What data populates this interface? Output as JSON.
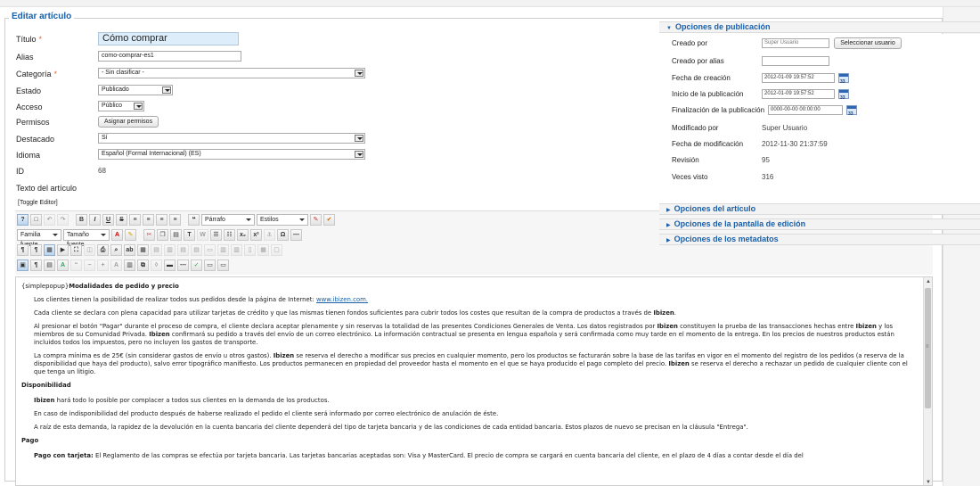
{
  "form": {
    "legend": "Editar artículo",
    "fields": {
      "titulo": {
        "label": "Título",
        "required_mark": "*",
        "value": "Cómo comprar"
      },
      "alias": {
        "label": "Alias",
        "value": "como-comprar-es1"
      },
      "categoria": {
        "label": "Categoría",
        "required_mark": "*",
        "value": "- Sin clasificar -"
      },
      "estado": {
        "label": "Estado",
        "value": "Publicado"
      },
      "acceso": {
        "label": "Acceso",
        "value": "Público"
      },
      "permisos": {
        "label": "Permisos",
        "button": "Asignar permisos"
      },
      "destacado": {
        "label": "Destacado",
        "value": "Sí"
      },
      "idioma": {
        "label": "Idioma",
        "value": "Español (Formal Internacional) (ES)"
      },
      "id": {
        "label": "ID",
        "value": "68"
      },
      "texto": {
        "label": "Texto del artículo"
      }
    },
    "toggle_editor": "[Toggle Editor]"
  },
  "toolbar": {
    "format_select": "Párrafo",
    "styles_select": "Estilos",
    "font_family": "Familia fuente",
    "font_size": "Tamaño fuente",
    "icons_row1": [
      "help-icon",
      "new-doc-icon",
      "undo-icon",
      "redo-icon",
      "bold-icon",
      "italic-icon",
      "underline-icon",
      "strikethrough-icon",
      "align-left-icon",
      "align-center-icon",
      "align-right-icon",
      "blockquote-icon",
      "clean-icon",
      "template-icon"
    ],
    "icon_glyphs_row1": [
      "?",
      "□",
      "↶",
      "↷",
      "B",
      "I",
      "U",
      "S",
      "≡",
      "≡",
      "≡",
      "❝",
      "✎",
      "✔"
    ]
  },
  "editor": {
    "p0_prefix": "{simplepopup}",
    "p0_bold": "Modalidades de pedido y precio",
    "p1_text": "Los clientes tienen la posibilidad de realizar todos sus pedidos desde la página de Internet: ",
    "p1_link": "www.ibizen.com.",
    "p2_text": "Cada cliente se declara con plena capacidad para utilizar tarjetas de crédito y que las mismas tienen fondos suficientes para cubrir todos los costes que resultan de la compra de productos a través de ",
    "p2_bold": "Ibizen",
    "p3_a": "Al presionar el botón \"Pagar\" durante el proceso de compra, el cliente declara aceptar plenamente y sin reservas la totalidad de las presentes Condiciones Generales de Venta. Los datos registrados por ",
    "p3_b1": "Ibizen",
    "p3_c": " constituyen la prueba de las transacciones hechas entre ",
    "p3_b2": "Ibizen",
    "p3_d": " y los miembros de su Comunidad Privada. ",
    "p3_b3": "Ibizen",
    "p3_e": " confirmará su pedido a través del envío de un correo electrónico. La información contractual se presenta en lengua española y será confirmada como muy tarde en el momento de la entrega. En los precios de nuestros productos están incluidos todos los impuestos, pero no incluyen los gastos de transporte.",
    "p4_a": "La compra mínima es de 25€ (sin considerar gastos de envío u otros gastos). ",
    "p4_b1": "Ibizen",
    "p4_c": " se reserva el derecho a modificar sus precios en cualquier momento, pero los productos se facturarán sobre la base de las tarifas en vigor en el momento del registro de los pedidos (a reserva de la disponibilidad que haya del producto), salvo error tipográfico manifiesto. Los productos permanecen en propiedad del proveedor hasta el momento en el que se haya producido el pago completo del precio. ",
    "p4_b2": "Ibizen",
    "p4_d": " se reserva el derecho a rechazar un pedido de cualquier cliente con el que tenga un litigio.",
    "h_disponibilidad": "Disponibilidad",
    "p5_bold": "Ibizen",
    "p5_text": " hará todo lo posible por complacer a todos sus clientes en la demanda de los productos.",
    "p6_text": "En caso de indisponibilidad del producto después de haberse realizado el pedido el cliente será informado por correo electrónico de anulación de éste.",
    "p7_text": "A raíz de esta demanda, la rapidez de la devolución en la cuenta bancaria del cliente dependerá del tipo de tarjeta bancaria y de las condiciones de cada entidad bancaria. Estos plazos de nuevo se precisan en la cláusula \"Entrega\".",
    "h_pago": "Pago",
    "p8_bold": "Pago con tarjeta:",
    "p8_text": " El Reglamento de las compras se efectúa por tarjeta bancaria. Las tarjetas bancarias aceptadas son: Visa y MasterCard. El precio de compra se cargará en cuenta bancaria del cliente, en el plazo de 4 días a contar desde el día del"
  },
  "publication": {
    "header": "Opciones de publicación",
    "creado_por": {
      "label": "Creado por",
      "value": "Super Usuario",
      "button": "Seleccionar usuario"
    },
    "creado_por_alias": {
      "label": "Creado por alias",
      "value": ""
    },
    "fecha_creacion": {
      "label": "Fecha de creación",
      "value": "2012-01-09 19:57:52"
    },
    "inicio_publicacion": {
      "label": "Inicio de la publicación",
      "value": "2012-01-09 19:57:52"
    },
    "fin_publicacion": {
      "label": "Finalización de la publicación",
      "value": "0000-00-00 00:00:00"
    },
    "modificado_por": {
      "label": "Modificado por",
      "value": "Super Usuario"
    },
    "fecha_modificacion": {
      "label": "Fecha de modificación",
      "value": "2012-11-30 21:37:59"
    },
    "revision": {
      "label": "Revisión",
      "value": "95"
    },
    "veces_visto": {
      "label": "Veces visto",
      "value": "316"
    }
  },
  "collapsed_panels": {
    "articulo": "Opciones del artículo",
    "pantalla": "Opciones de la pantalla de edición",
    "metadatos": "Opciones de los metadatos"
  }
}
